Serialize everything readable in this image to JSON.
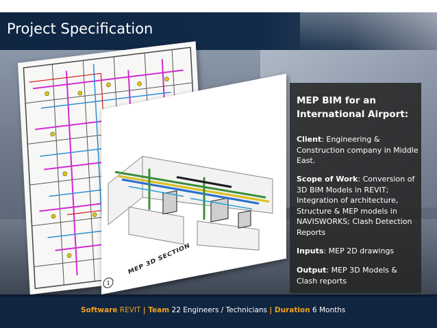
{
  "header": {
    "title": "Project Specification"
  },
  "drawing": {
    "section_label": "MEP 3D SECTION",
    "sheet_number": "1"
  },
  "panel": {
    "heading": "MEP BIM for an International Airport:",
    "client_label": "Client",
    "client_text": ": Engineering & Construction company in Middle East.",
    "scope_label": "Scope of Work",
    "scope_text": ": Conversion of 3D BIM Models in REVIT; Integration of  architecture, Structure  & MEP models in NAVISWORKS; Clash Detection Reports",
    "inputs_label": "Inputs",
    "inputs_text": ": MEP  2D drawings",
    "output_label": "Output",
    "output_text": ": MEP 3D Models & Clash reports"
  },
  "footer": {
    "software_label": "Software",
    "software_value": " REVIT ",
    "sep1": "| ",
    "team_label": "Team",
    "team_value": " 22 Engineers / Technicians ",
    "sep2": "| ",
    "duration_label": "Duration",
    "duration_value": " 6 Months"
  },
  "colors": {
    "header_bg": "#0f2542",
    "panel_bg": "#262626",
    "accent": "#f0a21c",
    "footer_bg": "#10253f"
  }
}
